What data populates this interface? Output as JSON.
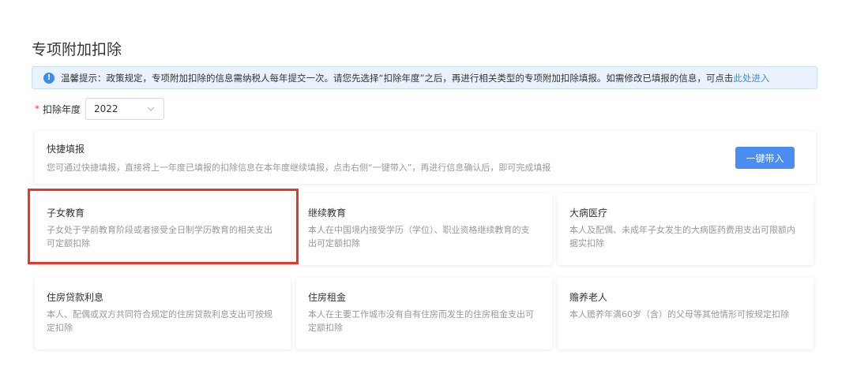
{
  "page_title": "专项附加扣除",
  "notice": {
    "icon": "info-icon",
    "icon_glyph": "!",
    "text": "温馨提示：政策规定，专项附加扣除的信息需纳税人每年提交一次。请您先选择“扣除年度”之后，再进行相关类型的专项附加扣除填报。如需修改已填报的信息，可点击",
    "link": "此处进入"
  },
  "year_field": {
    "required_mark": "*",
    "label": "扣除年度",
    "value": "2022"
  },
  "quick_fill": {
    "title": "快捷填报",
    "description": "您可通过快捷填报，直接将上一年度已填报的扣除信息在本年度继续填报，点击右侧“一键带入”，再进行信息确认后，即可完成填报",
    "button": "一键带入"
  },
  "deduction_items": [
    {
      "title": "子女教育",
      "description": "子女处于学前教育阶段或者接受全日制学历教育的相关支出可定额扣除"
    },
    {
      "title": "继续教育",
      "description": "本人在中国境内接受学历（学位）、职业资格继续教育的支出可定额扣除"
    },
    {
      "title": "大病医疗",
      "description": "本人及配偶、未成年子女发生的大病医药费用支出可限额内据实扣除"
    },
    {
      "title": "住房贷款利息",
      "description": "本人、配偶或双方共同符合规定的住房贷款利息支出可按规定扣除"
    },
    {
      "title": "住房租金",
      "description": "本人在主要工作城市没有自有住房而发生的住房租金支出可定额扣除"
    },
    {
      "title": "赡养老人",
      "description": "本人赡养年满60岁（含）的父母等其他情形可按规定扣除"
    }
  ],
  "colors": {
    "accent": "#4b8df0",
    "highlight_color": "#e8362b"
  }
}
